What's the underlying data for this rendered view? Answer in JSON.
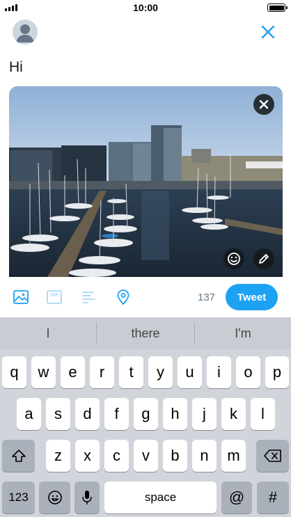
{
  "status_bar": {
    "time": "10:00"
  },
  "compose": {
    "text": "Hi"
  },
  "toolbar": {
    "char_count": "137",
    "tweet_label": "Tweet",
    "gif_label": "GIF"
  },
  "keyboard": {
    "predictions": [
      "I",
      "there",
      "I'm"
    ],
    "row1": [
      "q",
      "w",
      "e",
      "r",
      "t",
      "y",
      "u",
      "i",
      "o",
      "p"
    ],
    "row2": [
      "a",
      "s",
      "d",
      "f",
      "g",
      "h",
      "j",
      "k",
      "l"
    ],
    "row3": [
      "z",
      "x",
      "c",
      "v",
      "b",
      "n",
      "m"
    ],
    "numbers_label": "123",
    "space_label": "space",
    "at_label": "@",
    "hash_label": "#"
  },
  "colors": {
    "accent": "#1da1f2",
    "keyboard_bg": "#d1d5db"
  }
}
